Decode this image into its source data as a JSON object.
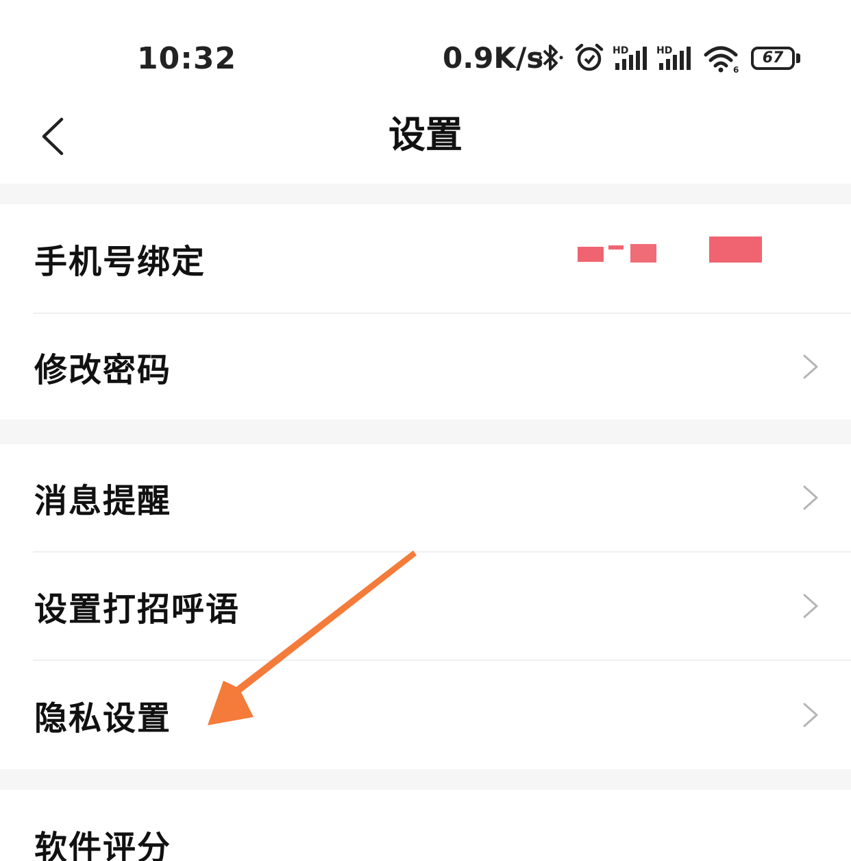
{
  "status_bar": {
    "time": "10:32",
    "network_speed": "0.9K/s",
    "battery_level": "67",
    "icons": [
      "bluetooth-icon",
      "alarm-icon",
      "signal-hd-icon",
      "signal-hd-icon",
      "wifi-icon",
      "battery-icon"
    ]
  },
  "nav": {
    "title": "设置",
    "back_icon": "chevron-left-icon"
  },
  "sections": {
    "account": {
      "phone_binding_label": "手机号绑定",
      "change_password_label": "修改密码"
    },
    "general": {
      "notification_label": "消息提醒",
      "greeting_label": "设置打招呼语",
      "privacy_label": "隐私设置"
    },
    "other": {
      "rate_label": "软件评分"
    }
  },
  "colors": {
    "background": "#ffffff",
    "section_gap": "#f6f6f7",
    "redaction": "#ef6470",
    "annotation_arrow": "#f47b3a",
    "chevron": "#b5b5b5"
  }
}
